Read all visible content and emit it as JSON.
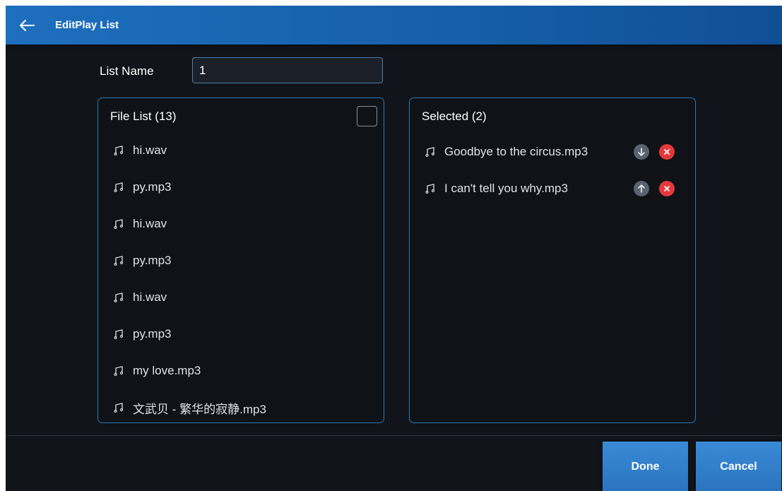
{
  "header": {
    "back_icon": "arrow-left-icon",
    "title": "EditPlay List"
  },
  "form": {
    "name_label": "List Name",
    "name_value": "1"
  },
  "file_list": {
    "title": "File List (13)",
    "items": [
      {
        "label": "hi.wav",
        "icon": "music-note-icon"
      },
      {
        "label": "py.mp3",
        "icon": "music-note-icon"
      },
      {
        "label": "hi.wav",
        "icon": "music-note-icon"
      },
      {
        "label": "py.mp3",
        "icon": "music-note-icon"
      },
      {
        "label": "hi.wav",
        "icon": "music-note-icon"
      },
      {
        "label": "py.mp3",
        "icon": "music-note-icon"
      },
      {
        "label": "my love.mp3",
        "icon": "music-note-icon"
      },
      {
        "label": "文武贝 - 繁华的寂静.mp3",
        "icon": "music-note-icon"
      }
    ]
  },
  "selected_list": {
    "title": "Selected (2)",
    "items": [
      {
        "label": "Goodbye to the circus.mp3",
        "move_icon": "arrow-down-icon",
        "remove_icon": "close-icon"
      },
      {
        "label": "I can't tell you why.mp3",
        "move_icon": "arrow-up-icon",
        "remove_icon": "close-icon"
      }
    ]
  },
  "footer": {
    "done_label": "Done",
    "cancel_label": "Cancel"
  },
  "colors": {
    "header_blue": "#1e6fbe",
    "button_blue": "#3a8ad6",
    "remove_red": "#e5383c",
    "panel_border": "#2f78b0",
    "background": "#11141a"
  }
}
